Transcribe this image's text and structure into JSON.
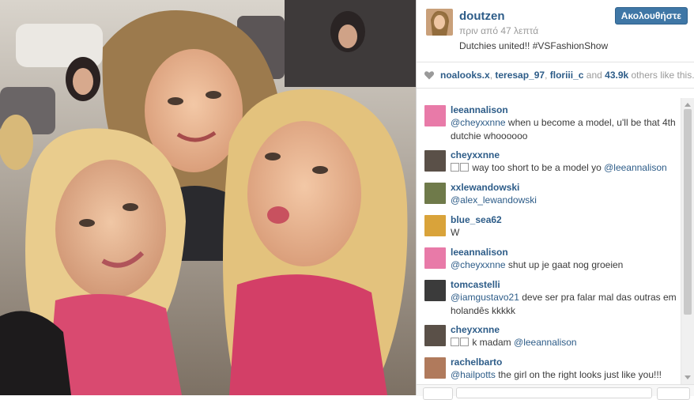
{
  "post": {
    "username": "doutzen",
    "time_ago": "πριν από 47 λεπτά",
    "caption": "Dutchies united!! #VSFashionShow",
    "follow_label": "Ακολουθήστε"
  },
  "likes": {
    "users": [
      "noalooks.x",
      "teresap_97",
      "floriii_c"
    ],
    "separator": ", ",
    "and": " and ",
    "count": "43.9k",
    "suffix": " others like this."
  },
  "comments": [
    {
      "user": "leeannalison",
      "avatar_color": "#e87aa8",
      "mention": "@cheyxxnne",
      "text": " when u become a model, u'll be that 4th dutchie whoooooo",
      "emoji": false
    },
    {
      "user": "cheyxxnne",
      "avatar_color": "#5a5048",
      "mention": "",
      "text": " way too short to be a model yo ",
      "trailing_mention": "@leeannalison",
      "emoji": true
    },
    {
      "user": "xxlewandowski",
      "avatar_color": "#6f7a4a",
      "mention": "@alex_lewandowski",
      "text": "",
      "emoji": false
    },
    {
      "user": "blue_sea62",
      "avatar_color": "#d9a33a",
      "mention": "",
      "text": "W",
      "emoji": false
    },
    {
      "user": "leeannalison",
      "avatar_color": "#e87aa8",
      "mention": "@cheyxxnne",
      "text": " shut up je gaat nog groeien",
      "emoji": false
    },
    {
      "user": "tomcastelli",
      "avatar_color": "#3b3b3b",
      "mention": "@iamgustavo21",
      "text": " deve ser pra falar mal das outras em holandês kkkkk",
      "emoji": false
    },
    {
      "user": "cheyxxnne",
      "avatar_color": "#5a5048",
      "mention": "",
      "text": " k madam ",
      "trailing_mention": "@leeannalison",
      "emoji": true
    },
    {
      "user": "rachelbarto",
      "avatar_color": "#b07a5c",
      "mention": "@hailpotts",
      "text": " the girl on the right looks just like you!!!",
      "emoji": false
    }
  ],
  "colors": {
    "link": "#2d5c88",
    "follow_button": "#3f77a6",
    "muted": "#9a9a9a"
  },
  "icons": {
    "likes": "heart-icon",
    "emoji_placeholder": "missing-glyph-box"
  }
}
